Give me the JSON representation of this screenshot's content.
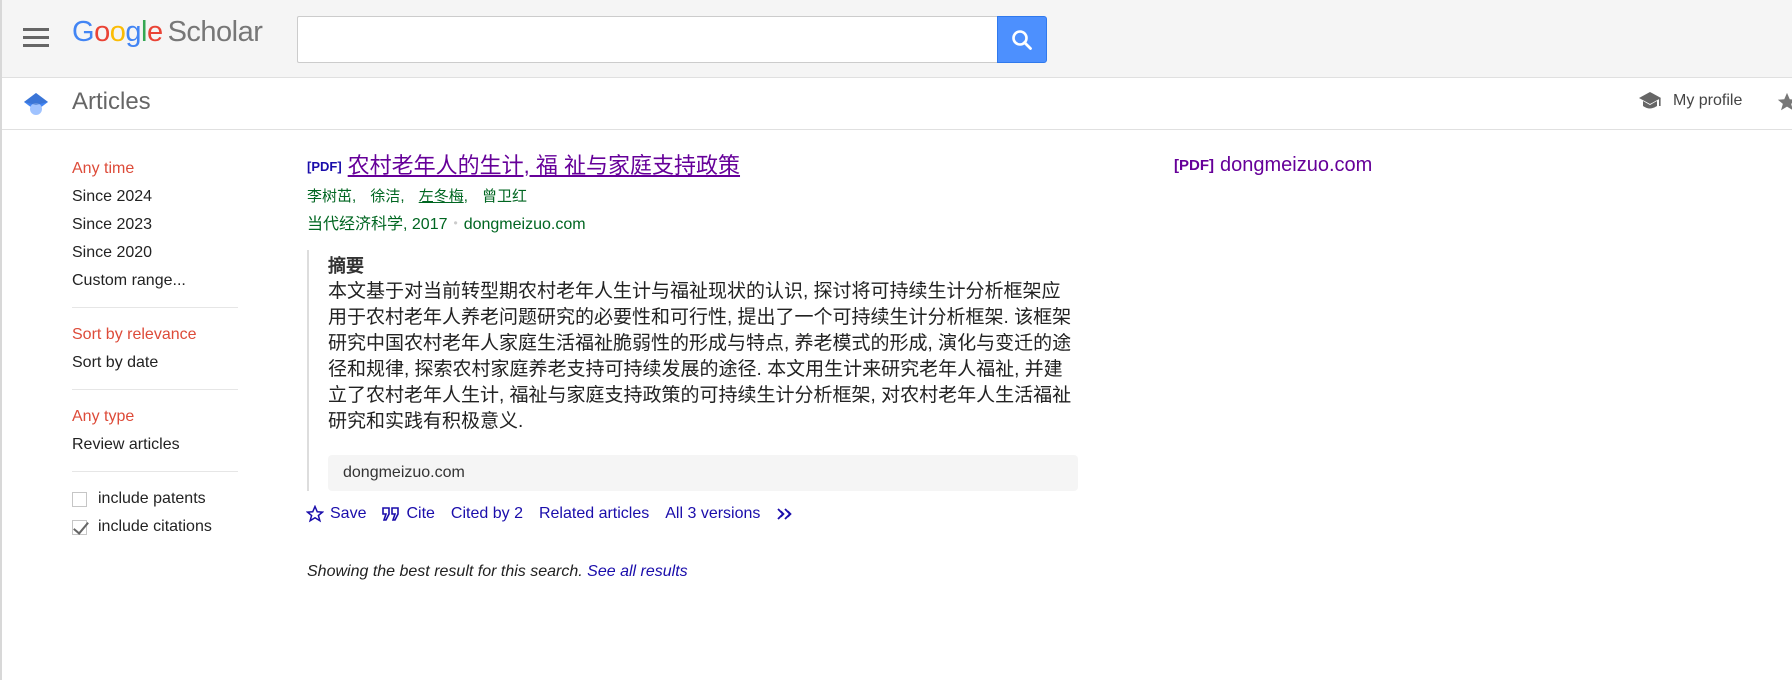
{
  "header": {
    "logo_google": [
      "G",
      "o",
      "o",
      "g",
      "l",
      "e"
    ],
    "logo_scholar": "Scholar",
    "search": {
      "value": "",
      "placeholder": ""
    },
    "search_icon": "search-icon",
    "menu_icon": "hamburger-menu-icon"
  },
  "subbar": {
    "title": "Articles",
    "my_profile": "My profile",
    "icons": [
      "scholar-cap-icon",
      "graduation-cap-icon",
      "star-icon"
    ]
  },
  "sidebar": {
    "time_filters": [
      {
        "label": "Any time",
        "active": true
      },
      {
        "label": "Since 2024",
        "active": false
      },
      {
        "label": "Since 2023",
        "active": false
      },
      {
        "label": "Since 2020",
        "active": false
      },
      {
        "label": "Custom range...",
        "active": false
      }
    ],
    "sort_options": [
      {
        "label": "Sort by relevance",
        "active": true
      },
      {
        "label": "Sort by date",
        "active": false
      }
    ],
    "type_filters": [
      {
        "label": "Any type",
        "active": true
      },
      {
        "label": "Review articles",
        "active": false
      }
    ],
    "checkboxes": [
      {
        "label": "include patents",
        "checked": false
      },
      {
        "label": "include citations",
        "checked": true
      }
    ]
  },
  "result": {
    "pdf_tag": "[PDF]",
    "title": "农村老年人的生计, 福 祉与家庭支持政策",
    "authors": [
      {
        "name": "李树茁,",
        "linked": false
      },
      {
        "name": "徐洁,",
        "linked": false
      },
      {
        "name": "左冬梅",
        "linked": true
      },
      {
        "name": ",",
        "linked": false
      },
      {
        "name": "曾卫红",
        "linked": false
      }
    ],
    "venue": "当代经济科学, 2017",
    "venue_separator": "•",
    "domain": "dongmeizuo.com",
    "abstract_label": "摘要",
    "abstract": "本文基于对当前转型期农村老年人生计与福祉现状的认识, 探讨将可持续生计分析框架应用于农村老年人养老问题研究的必要性和可行性, 提出了一个可持续生计分析框架. 该框架研究中国农村老年人家庭生活福祉脆弱性的形成与特点, 养老模式的形成, 演化与变迁的途径和规律, 探索农村家庭养老支持可持续发展的途径. 本文用生计来研究老年人福祉, 并建立了农村老年人生计, 福祉与家庭支持政策的可持续生计分析框架, 对农村老年人生活福祉研究和实践有积极意义.",
    "source_box": "dongmeizuo.com",
    "actions": {
      "save": "Save",
      "cite": "Cite",
      "cited_by": "Cited by 2",
      "related": "Related articles",
      "versions": "All 3 versions"
    }
  },
  "side_pdf": {
    "tag": "[PDF]",
    "domain": "dongmeizuo.com"
  },
  "footer_note": {
    "text": "Showing the best result for this search.",
    "link": "See all results"
  },
  "colors": {
    "accent_blue": "#4d90fe",
    "active_red": "#dd4b39",
    "link_blue": "#1a0dab",
    "visited_purple": "#660099",
    "green": "#006621"
  }
}
